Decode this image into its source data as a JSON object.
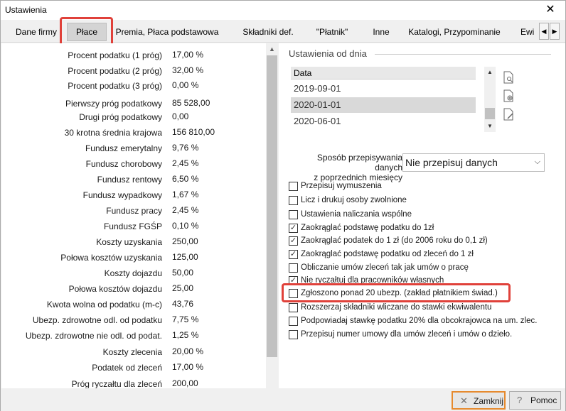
{
  "window": {
    "title": "Ustawienia",
    "close_glyph": "✕"
  },
  "tabs": [
    {
      "label": "Dane firmy"
    },
    {
      "label": "Płace",
      "active": true
    },
    {
      "label": "Premia, Płaca podstawowa"
    },
    {
      "label": "Składniki def."
    },
    {
      "label": "\"Płatnik\""
    },
    {
      "label": "Inne"
    },
    {
      "label": "Katalogi, Przypominanie"
    },
    {
      "label": "Ewi"
    }
  ],
  "tab_scroll": {
    "left_glyph": "◀",
    "right_glyph": "▶"
  },
  "params": [
    {
      "label": "Procent podatku (1 próg)",
      "value": "17,00 %"
    },
    {
      "label": "Procent podatku (2 próg)",
      "value": "32,00 %"
    },
    {
      "label": "Procent podatku (3 próg)",
      "value": "0,00 %"
    },
    {
      "label": "Pierwszy próg podatkowy",
      "value": "85 528,00"
    },
    {
      "label": "Drugi próg podatkowy",
      "value": "0,00"
    },
    {
      "label": "30 krotna średnia krajowa",
      "value": "156 810,00"
    },
    {
      "label": "Fundusz emerytalny",
      "value": "9,76 %"
    },
    {
      "label": "Fundusz chorobowy",
      "value": "2,45 %"
    },
    {
      "label": "Fundusz rentowy",
      "value": "6,50 %"
    },
    {
      "label": "Fundusz wypadkowy",
      "value": "1,67 %"
    },
    {
      "label": "Fundusz pracy",
      "value": "2,45 %"
    },
    {
      "label": "Fundusz FGŚP",
      "value": "0,10 %"
    },
    {
      "label": "Koszty uzyskania",
      "value": "250,00"
    },
    {
      "label": "Połowa kosztów uzyskania",
      "value": "125,00"
    },
    {
      "label": "Koszty dojazdu",
      "value": "50,00"
    },
    {
      "label": "Połowa kosztów dojazdu",
      "value": "25,00"
    },
    {
      "label": "Kwota wolna od podatku (m-c)",
      "value": "43,76"
    },
    {
      "label": "Ubezp. zdrowotne odl. od podatku",
      "value": "7,75 %"
    },
    {
      "label": "Ubezp. zdrowotne nie odl. od podat.",
      "value": "1,25 %"
    },
    {
      "label": "Koszty zlecenia",
      "value": "20,00 %"
    },
    {
      "label": "Podatek od zleceń",
      "value": "17,00 %"
    },
    {
      "label": "Próg ryczałtu dla zleceń",
      "value": "200,00"
    }
  ],
  "settings_from_day": {
    "title": "Ustawienia od dnia",
    "column_header": "Data",
    "dates": [
      {
        "value": "2019-09-01",
        "selected": false
      },
      {
        "value": "2020-01-01",
        "selected": true
      },
      {
        "value": "2020-06-01",
        "selected": false
      }
    ],
    "icons": [
      "document-search-icon",
      "document-add-icon",
      "document-edit-icon"
    ]
  },
  "copy_mode": {
    "label_line1": "Sposób przepisywania danych",
    "label_line2": "z poprzednich miesięcy",
    "value": "Nie przepisuj danych"
  },
  "checkboxes": [
    {
      "label": "Przepisuj wymuszenia",
      "checked": false
    },
    {
      "label": "Licz i drukuj osoby zwolnione",
      "checked": false
    },
    {
      "label": "Ustawienia naliczania wspólne",
      "checked": false
    },
    {
      "label": "Zaokrąglać podstawę podatku do 1zł",
      "checked": true
    },
    {
      "label": "Zaokrąglać podatek do 1 zł (do 2006 roku do 0,1 zł)",
      "checked": true
    },
    {
      "label": "Zaokrąglać podstawę podatku od zleceń do 1 zł",
      "checked": true
    },
    {
      "label": "Obliczanie umów zleceń tak jak umów o pracę",
      "checked": false
    },
    {
      "label": "Nie ryczałtuj dla pracowników własnych",
      "checked": true
    },
    {
      "label": "Zgłoszono ponad 20 ubezp. (zakład płatnikiem świad.)",
      "checked": false
    },
    {
      "label": "Rozszerzaj składniki wliczane do stawki ekwiwalentu",
      "checked": false
    },
    {
      "label": "Podpowiadaj stawkę podatku 20% dla obcokrajowca na um. zlec.",
      "checked": false
    },
    {
      "label": "Przepisuj numer umowy dla umów zleceń i umów o dzieło.",
      "checked": false
    }
  ],
  "footer": {
    "close_label": "Zamknij",
    "help_label": "Pomoc"
  },
  "colors": {
    "highlight": "#e0413a",
    "focus": "#e68a2e"
  }
}
